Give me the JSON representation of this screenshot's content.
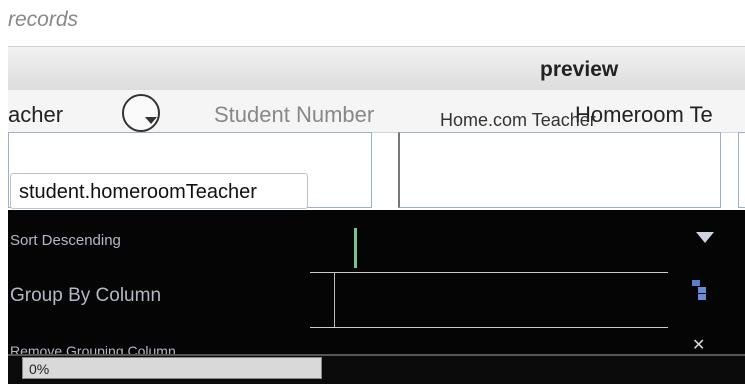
{
  "section": {
    "label": "records"
  },
  "preview": {
    "title": "preview"
  },
  "columns": {
    "first_header": "acher",
    "student_number": "Student Number",
    "homeroom_teacher": "Homeroom Te",
    "ghost": "Home.com Teacher"
  },
  "binding": {
    "field_value": "student.homeroomTeacher"
  },
  "context_menu": {
    "items": [
      {
        "label": "Sort Descending",
        "icon": "sort-descending-icon"
      },
      {
        "label": "Group By Column",
        "icon": "group-by-icon"
      },
      {
        "label": "Remove Grouping Column",
        "icon": "remove-grouping-icon"
      }
    ]
  },
  "filter": {
    "value": "0%"
  }
}
